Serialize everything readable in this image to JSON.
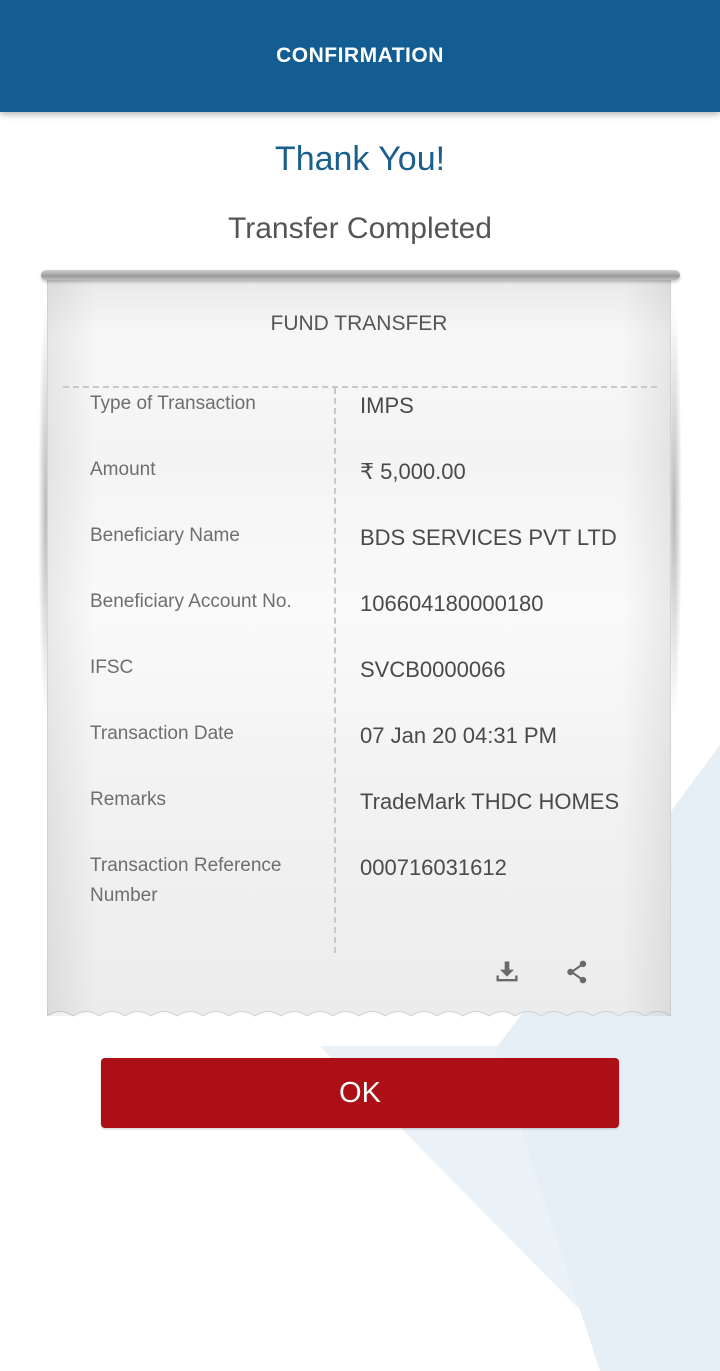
{
  "header": {
    "title": "CONFIRMATION"
  },
  "confirmation": {
    "heading": "Thank You!",
    "subheading": "Transfer Completed"
  },
  "receipt": {
    "title": "FUND TRANSFER",
    "rows": [
      {
        "label": "Type of Transaction",
        "value": "IMPS"
      },
      {
        "label": "Amount",
        "value": "₹ 5,000.00"
      },
      {
        "label": "Beneficiary Name",
        "value": "BDS SERVICES PVT LTD"
      },
      {
        "label": "Beneficiary Account No.",
        "value": "106604180000180"
      },
      {
        "label": "IFSC",
        "value": "SVCB0000066"
      },
      {
        "label": "Transaction Date",
        "value": "07 Jan 20 04:31 PM"
      },
      {
        "label": "Remarks",
        "value": "TradeMark THDC HOMES"
      },
      {
        "label": "Transaction Reference Number",
        "value": "000716031612"
      }
    ],
    "actions": {
      "download_icon": "download-icon",
      "share_icon": "share-icon"
    }
  },
  "ok_button": {
    "label": "OK"
  },
  "colors": {
    "header": "#135d93",
    "heading": "#1a5f8e",
    "ok_button": "#ac1016"
  }
}
